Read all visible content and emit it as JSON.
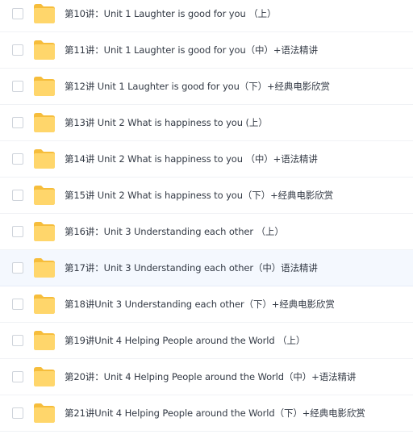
{
  "file_list": {
    "items": [
      {
        "name": "第10讲：Unit 1 Laughter is good for you （上）",
        "icon": "folder-icon"
      },
      {
        "name": "第11讲：Unit 1 Laughter is good for you（中）+语法精讲",
        "icon": "folder-icon"
      },
      {
        "name": "第12讲 Unit 1 Laughter is good for you（下）+经典电影欣赏",
        "icon": "folder-icon"
      },
      {
        "name": "第13讲 Unit 2 What is happiness to you (上）",
        "icon": "folder-icon"
      },
      {
        "name": "第14讲 Unit 2 What is happiness to you （中）+语法精讲",
        "icon": "folder-icon"
      },
      {
        "name": "第15讲 Unit 2 What is happiness to you（下）+经典电影欣赏",
        "icon": "folder-icon"
      },
      {
        "name": "第16讲：Unit 3 Understanding each other （上）",
        "icon": "folder-icon"
      },
      {
        "name": "第17讲：Unit 3 Understanding each other（中）语法精讲",
        "icon": "folder-icon",
        "hovered": true
      },
      {
        "name": "第18讲Unit 3 Understanding each other（下）+经典电影欣赏",
        "icon": "folder-icon"
      },
      {
        "name": "第19讲Unit 4 Helping People around the World （上）",
        "icon": "folder-icon"
      },
      {
        "name": "第20讲：Unit 4 Helping People around the World（中）+语法精讲",
        "icon": "folder-icon"
      },
      {
        "name": "第21讲Unit 4 Helping People around the World（下）+经典电影欣赏",
        "icon": "folder-icon"
      }
    ]
  },
  "colors": {
    "folder_body": "#ffd66b",
    "folder_back": "#f6bd3b",
    "hover_row": "#f4f8fe",
    "text": "#333a45"
  }
}
